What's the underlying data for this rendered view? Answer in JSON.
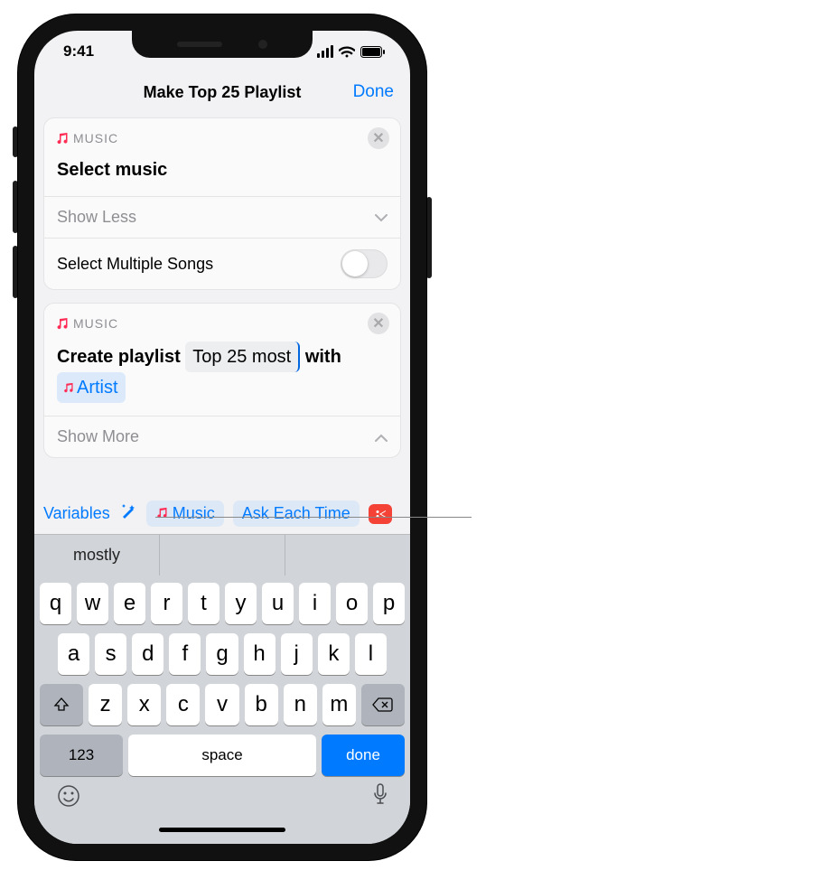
{
  "status": {
    "time": "9:41"
  },
  "nav": {
    "title": "Make Top 25 Playlist",
    "done": "Done"
  },
  "card1": {
    "app": "MUSIC",
    "title": "Select music",
    "show_less": "Show Less",
    "multi_label": "Select Multiple Songs"
  },
  "card2": {
    "app": "MUSIC",
    "prefix": "Create playlist",
    "field_value": "Top 25 most",
    "mid": "with",
    "token": "Artist",
    "show_more": "Show More"
  },
  "vartool": {
    "variables": "Variables",
    "music": "Music",
    "ask": "Ask Each Time"
  },
  "predict": {
    "s1": "mostly",
    "s2": "",
    "s3": ""
  },
  "keyboard": {
    "rows": [
      [
        "q",
        "w",
        "e",
        "r",
        "t",
        "y",
        "u",
        "i",
        "o",
        "p"
      ],
      [
        "a",
        "s",
        "d",
        "f",
        "g",
        "h",
        "j",
        "k",
        "l"
      ],
      [
        "z",
        "x",
        "c",
        "v",
        "b",
        "n",
        "m"
      ]
    ],
    "num": "123",
    "space": "space",
    "done": "done"
  }
}
